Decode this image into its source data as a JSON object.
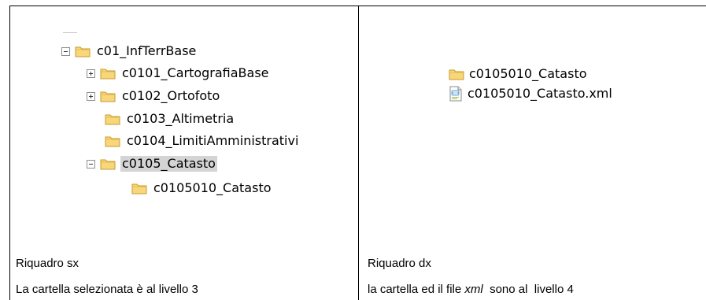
{
  "left_panel": {
    "tree": [
      {
        "label": "c01_InfTerrBase",
        "toggle": "minus",
        "selected": false
      },
      {
        "label": "c0101_CartografiaBase",
        "toggle": "plus",
        "selected": false
      },
      {
        "label": "c0102_Ortofoto",
        "toggle": "plus",
        "selected": false
      },
      {
        "label": "c0103_Altimetria",
        "toggle": "none",
        "selected": false
      },
      {
        "label": "c0104_LimitiAmministrativi",
        "toggle": "none",
        "selected": false
      },
      {
        "label": "c0105_Catasto",
        "toggle": "minus",
        "selected": true
      },
      {
        "label": "c0105010_Catasto",
        "toggle": "none",
        "selected": false
      }
    ],
    "caption_title": "Riquadro sx",
    "caption_text": "La cartella selezionata è al livello 3"
  },
  "right_panel": {
    "items": [
      {
        "label": "c0105010_Catasto",
        "icon": "folder-icon"
      },
      {
        "label": "c0105010_Catasto.xml",
        "icon": "xml-file-icon"
      }
    ],
    "caption_title": "Riquadro dx",
    "caption_text_before": "la cartella ed il file ",
    "caption_text_em": "xml",
    "caption_text_after": "  sono al  livello 4"
  },
  "colors": {
    "folder_fill": "#f7d77a",
    "folder_stroke": "#c99a2e",
    "selection": "#d4d4d4"
  }
}
